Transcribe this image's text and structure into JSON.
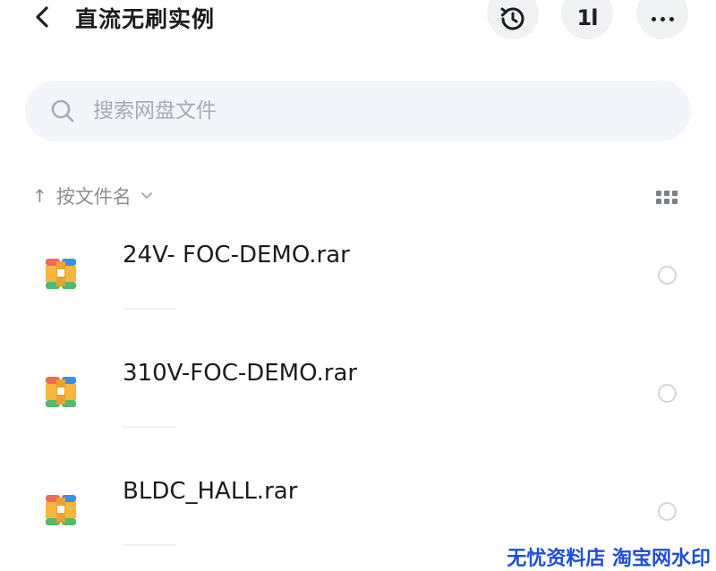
{
  "header": {
    "title": "直流无刷实例",
    "back_icon": "chevron-left-icon",
    "history_icon": "history-icon",
    "sort_icon_text": "1l",
    "more_icon": "more-horizontal-icon"
  },
  "search": {
    "placeholder": "搜索网盘文件",
    "value": ""
  },
  "sort": {
    "arrow": "↑",
    "label": "按文件名",
    "view_icon": "grid-view-icon"
  },
  "files": [
    {
      "name": "24V- FOC-DEMO.rar",
      "type": "archive-icon"
    },
    {
      "name": "310V-FOC-DEMO.rar",
      "type": "archive-icon"
    },
    {
      "name": "BLDC_HALL.rar",
      "type": "archive-icon"
    }
  ],
  "watermark": "无忧资料店 淘宝网水印",
  "colors": {
    "accent_watermark": "#1f4fd9",
    "search_bg": "#f3f5fa",
    "muted_text": "#8a8d94"
  }
}
